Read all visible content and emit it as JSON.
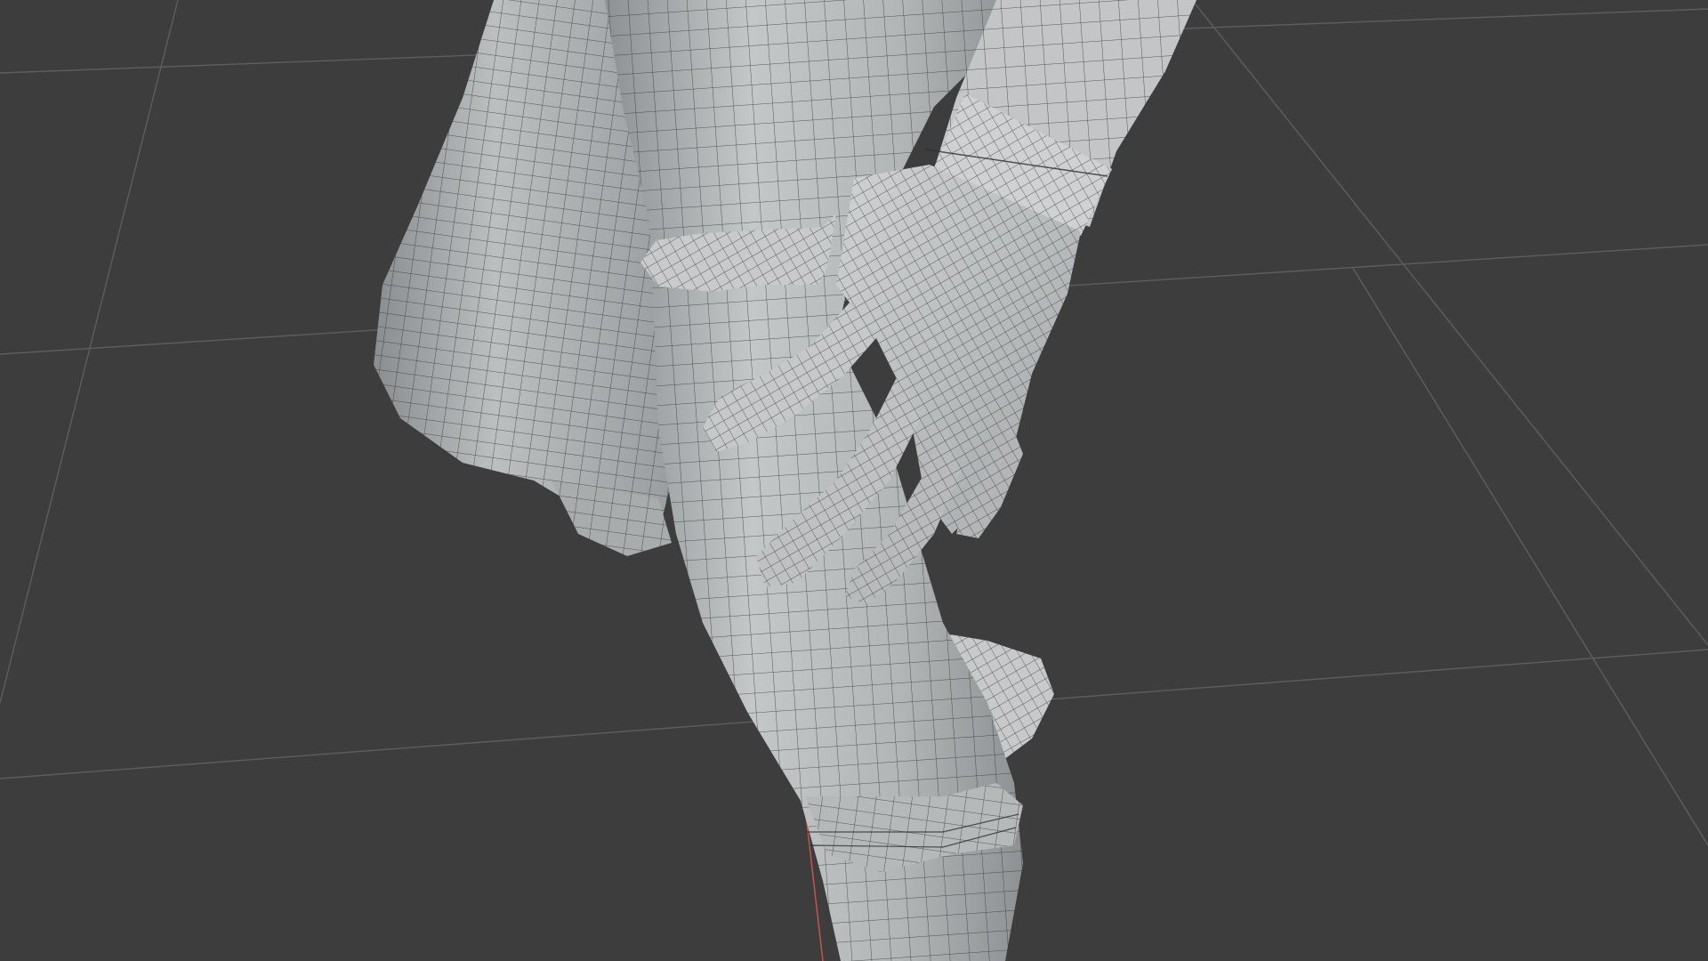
{
  "viewport": {
    "background": "#3d3d3d",
    "grid_color": "#5e5e5e",
    "axis_x_color": "#c9524f",
    "mesh_fill": "#b9bcbd",
    "mesh_shadow": "#8e9193",
    "mesh_highlight": "#d2d4d5",
    "wire_color": "#2a2a2a",
    "shading_mode": "solid",
    "overlay": "wireframe"
  }
}
